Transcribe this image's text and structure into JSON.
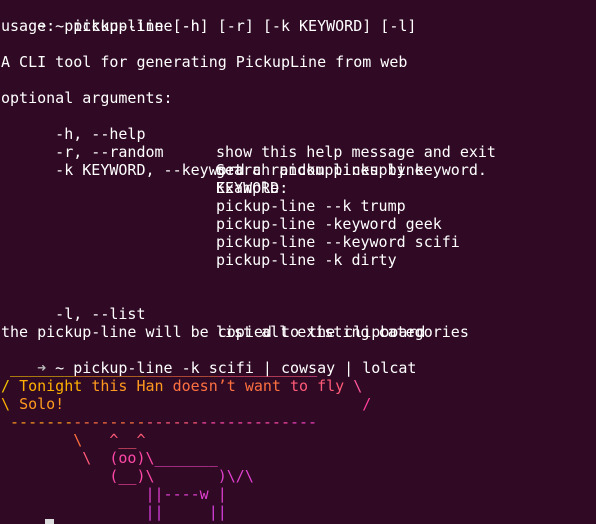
{
  "colors": {
    "background": "#300a24",
    "foreground": "#ffffff",
    "prompt_arrow": "#b8b8b8"
  },
  "terminal": {
    "prompt1": {
      "arrow": "➜",
      "dir": " ~",
      "command": " pickup-line -h"
    },
    "usage": "usage: pickup-line [-h] [-r] [-k KEYWORD] [-l]",
    "description": "A CLI tool for generating PickupLine from web",
    "optional_header": "optional arguments:",
    "opt_h": {
      "flag": "  -h, --help",
      "desc": "show this help message and exit"
    },
    "opt_r": {
      "flag": "  -r, --random",
      "desc": "get a random pickupline"
    },
    "opt_k": {
      "flag": "  -k KEYWORD, --keyword",
      "desc": "KEYWORD"
    },
    "opt_k_desc1": "Search pickuplines by keyword.",
    "opt_k_desc2": "Example:",
    "opt_k_ex1": "pickup-line --k trump",
    "opt_k_ex2": "pickup-line -keyword geek",
    "opt_k_ex3": "pickup-line --keyword scifi",
    "opt_k_ex4": "pickup-line -k dirty",
    "opt_l": {
      "flag": "  -l, --list",
      "desc": "list all existing categories"
    },
    "clipboard_note": "the pickup-line will be copied to the clipboard",
    "prompt2": {
      "arrow": "➜",
      "dir": " ~",
      "command": " pickup-line -k scifi | cowsay | lolcat"
    }
  },
  "cowsay": [
    [
      {
        "t": " ",
        "c": "#ffffff"
      },
      {
        "t": "_______",
        "c": "#f5c400"
      },
      {
        "t": "________",
        "c": "#ff9a1e"
      },
      {
        "t": "________",
        "c": "#ff7040"
      },
      {
        "t": "__________",
        "c": "#ff5a78"
      },
      {
        "t": "_",
        "c": "#ff58a0"
      }
    ],
    [
      {
        "t": "/ ",
        "c": "#f5c400"
      },
      {
        "t": "Tonight ",
        "c": "#ffb000"
      },
      {
        "t": "this Han ",
        "c": "#ff9a1e"
      },
      {
        "t": "doesn’t want ",
        "c": "#ff7040"
      },
      {
        "t": "to fly ",
        "c": "#ff5a78"
      },
      {
        "t": "\\",
        "c": "#ff58a0"
      }
    ],
    [
      {
        "t": "\\ ",
        "c": "#ffb000"
      },
      {
        "t": "Solo!",
        "c": "#ff9a1e"
      },
      {
        "t": "                                 ",
        "c": "#ffffff"
      },
      {
        "t": "/",
        "c": "#ff3e9c"
      }
    ],
    [
      {
        "t": " -------",
        "c": "#ff9a1e"
      },
      {
        "t": "--------",
        "c": "#ff7040"
      },
      {
        "t": "------",
        "c": "#ff5a78"
      },
      {
        "t": "----------",
        "c": "#ff48a8"
      },
      {
        "t": "---",
        "c": "#f040c0"
      }
    ],
    [
      {
        "t": "        \\",
        "c": "#ff7040"
      },
      {
        "t": "   ^__^",
        "c": "#ff5a78"
      }
    ],
    [
      {
        "t": "         \\  ",
        "c": "#ff5a78"
      },
      {
        "t": "(oo)\\",
        "c": "#ff48a8"
      },
      {
        "t": "_______",
        "c": "#f040c0"
      }
    ],
    [
      {
        "t": "            ",
        "c": "#ffffff"
      },
      {
        "t": "(__)\\",
        "c": "#ff48a8"
      },
      {
        "t": "       )\\/\\",
        "c": "#e040d0"
      }
    ],
    [
      {
        "t": "                ",
        "c": "#ffffff"
      },
      {
        "t": "||----w |",
        "c": "#e040d0"
      }
    ],
    [
      {
        "t": "                ",
        "c": "#ffffff"
      },
      {
        "t": "||     ||",
        "c": "#d840e0"
      }
    ]
  ]
}
